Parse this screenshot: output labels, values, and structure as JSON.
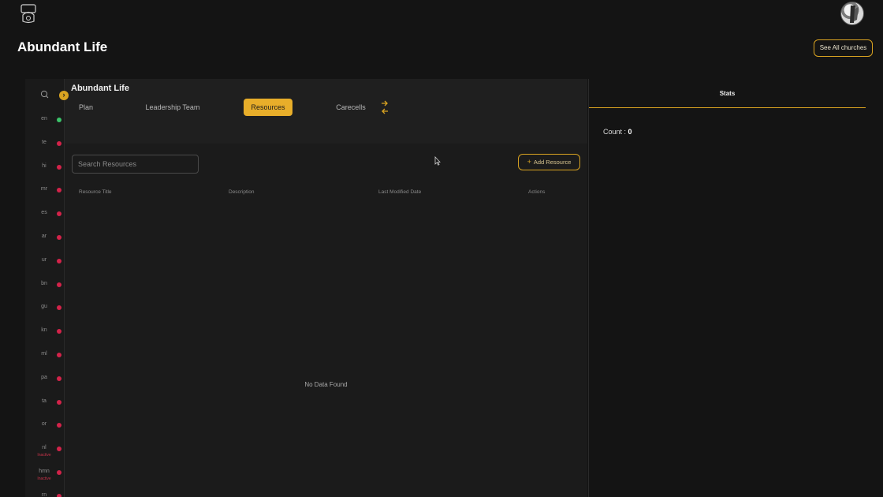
{
  "header": {
    "page_title": "Abundant Life",
    "see_all_label": "See All churches"
  },
  "rail": {
    "languages": [
      {
        "code": "en",
        "status": "green",
        "sub": ""
      },
      {
        "code": "te",
        "status": "red",
        "sub": ""
      },
      {
        "code": "hi",
        "status": "red",
        "sub": ""
      },
      {
        "code": "mr",
        "status": "red",
        "sub": ""
      },
      {
        "code": "es",
        "status": "red",
        "sub": ""
      },
      {
        "code": "ar",
        "status": "red",
        "sub": ""
      },
      {
        "code": "ur",
        "status": "red",
        "sub": ""
      },
      {
        "code": "bn",
        "status": "red",
        "sub": ""
      },
      {
        "code": "gu",
        "status": "red",
        "sub": ""
      },
      {
        "code": "kn",
        "status": "red",
        "sub": ""
      },
      {
        "code": "ml",
        "status": "red",
        "sub": ""
      },
      {
        "code": "pa",
        "status": "red",
        "sub": ""
      },
      {
        "code": "ta",
        "status": "red",
        "sub": ""
      },
      {
        "code": "or",
        "status": "red",
        "sub": ""
      },
      {
        "code": "nl",
        "status": "red",
        "sub": "Inactive"
      },
      {
        "code": "hmn",
        "status": "red",
        "sub": "Inactive"
      },
      {
        "code": "rn",
        "status": "red",
        "sub": ""
      }
    ]
  },
  "panel": {
    "church_name": "Abundant Life",
    "tabs": [
      {
        "label": "Plan",
        "active": false
      },
      {
        "label": "Leadership Team",
        "active": false
      },
      {
        "label": "Resources",
        "active": true
      },
      {
        "label": "Carecells",
        "active": false
      }
    ],
    "search_placeholder": "Search Resources",
    "add_button_label": "Add Resource",
    "columns": [
      "Resource Title",
      "Description",
      "Last Modified Date",
      "Actions"
    ],
    "empty_text": "No Data Found"
  },
  "stats": {
    "tab_label": "Stats",
    "count_label": "Count :",
    "count_value": "0"
  },
  "colors": {
    "accent": "#e8ae2a",
    "background": "#141414",
    "panel": "#1b1b1b",
    "active_dot": "#3bc46a",
    "inactive_dot": "#d3234a"
  }
}
